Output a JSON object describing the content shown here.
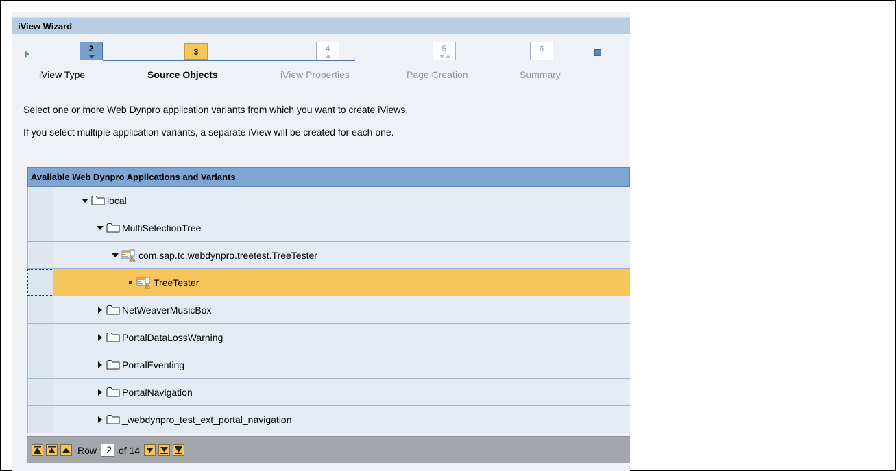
{
  "wizard": {
    "title": "iView Wizard"
  },
  "roadmap": {
    "steps": [
      {
        "number": "2",
        "label": "iView Type",
        "state": "done"
      },
      {
        "number": "3",
        "label": "Source Objects",
        "state": "active"
      },
      {
        "number": "4",
        "label": "iView Properties",
        "state": "future"
      },
      {
        "number": "5",
        "label": "Page Creation",
        "state": "future"
      },
      {
        "number": "6",
        "label": "Summary",
        "state": "future"
      }
    ]
  },
  "instructions": {
    "line1": "Select one or more Web Dynpro application variants from which you want to create iViews.",
    "line2": "If you select multiple application variants, a separate iView will be created for each one."
  },
  "table": {
    "header": "Available Web Dynpro Applications and Variants",
    "rows": [
      {
        "label": "local",
        "type": "folder",
        "expand": "expanded",
        "selected": false
      },
      {
        "label": "MultiSelectionTree",
        "type": "folder",
        "expand": "expanded",
        "selected": false
      },
      {
        "label": "com.sap.tc.webdynpro.treetest.TreeTester",
        "type": "application",
        "expand": "expanded",
        "selected": false
      },
      {
        "label": "TreeTester",
        "type": "application",
        "expand": "leaf",
        "selected": true
      },
      {
        "label": "NetWeaverMusicBox",
        "type": "folder",
        "expand": "collapsed",
        "selected": false
      },
      {
        "label": "PortalDataLossWarning",
        "type": "folder",
        "expand": "collapsed",
        "selected": false
      },
      {
        "label": "PortalEventing",
        "type": "folder",
        "expand": "collapsed",
        "selected": false
      },
      {
        "label": "PortalNavigation",
        "type": "folder",
        "expand": "collapsed",
        "selected": false
      },
      {
        "label": "_webdynpro_test_ext_portal_navigation",
        "type": "folder",
        "expand": "collapsed",
        "selected": false
      }
    ],
    "pager": {
      "row_label": "Row",
      "current_row": "2",
      "of_label": "of 14"
    }
  },
  "colors": {
    "title_bar": "#b9cde2",
    "table_header": "#7fa5d3",
    "selected_row": "#f8c55c",
    "active_step": "#f5c55b",
    "done_step": "#7a9ed0"
  }
}
